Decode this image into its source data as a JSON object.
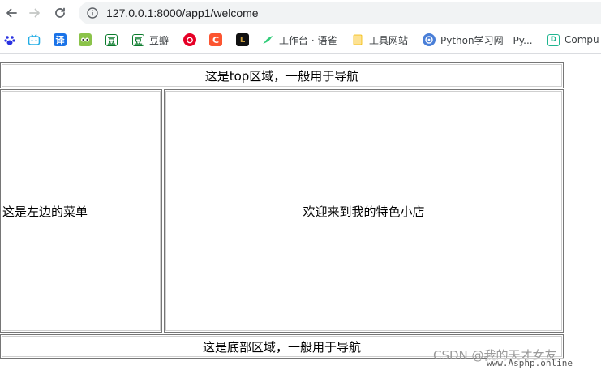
{
  "browser": {
    "url": "127.0.0.1:8000/app1/welcome",
    "bookmarks": [
      {
        "icon": "baidu-icon",
        "label": ""
      },
      {
        "icon": "bilibili-icon",
        "label": ""
      },
      {
        "icon": "translate-icon",
        "label": ""
      },
      {
        "icon": "iqiyi-icon",
        "label": ""
      },
      {
        "icon": "douban-icon",
        "label": ""
      },
      {
        "icon": "douban-icon",
        "label": "豆瓣"
      },
      {
        "icon": "netease-music-icon",
        "label": ""
      },
      {
        "icon": "csdn-icon",
        "label": ""
      },
      {
        "icon": "league-icon",
        "label": ""
      },
      {
        "icon": "yuque-icon",
        "label": "工作台 · 语雀"
      },
      {
        "icon": "folder-icon",
        "label": "工具网站"
      },
      {
        "icon": "python-icon",
        "label": "Python学习网 - Py..."
      },
      {
        "icon": "computer-icon",
        "label": "Compu"
      }
    ]
  },
  "page": {
    "top": "这是top区域，一般用于导航",
    "left": "这是左边的菜单",
    "main": "欢迎来到我的特色小店",
    "footer": "这是底部区域，一般用于导航"
  },
  "watermark": {
    "text": "CSDN @我的天才女友",
    "site": "www.Asphp.online"
  }
}
